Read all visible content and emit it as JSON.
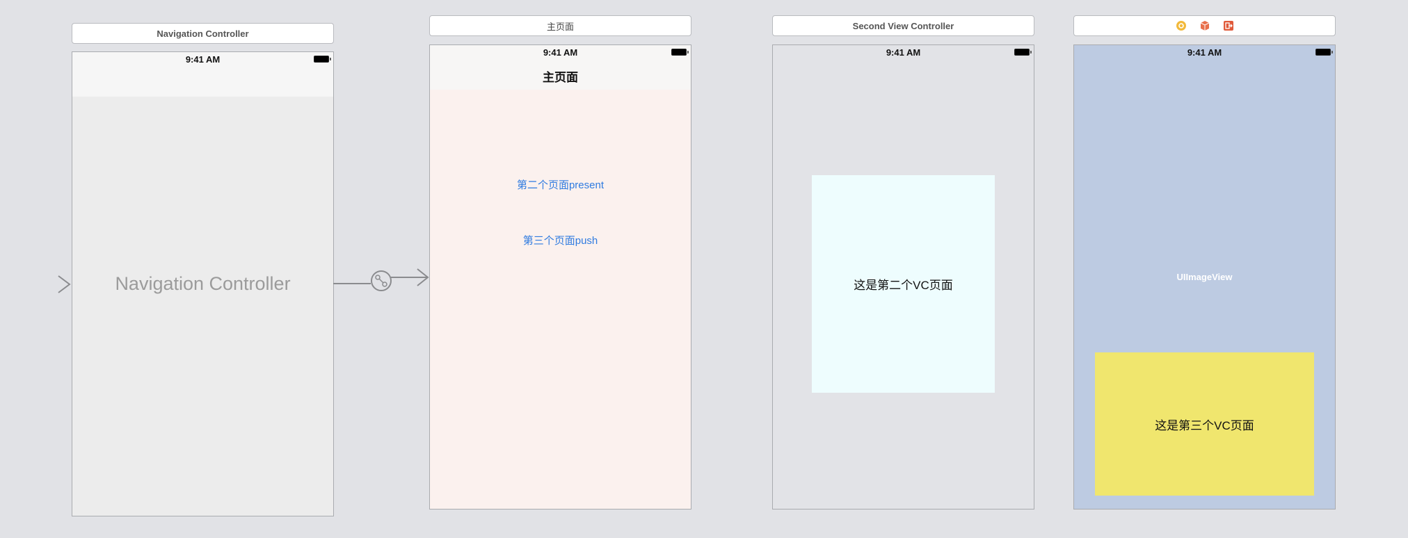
{
  "scenes": {
    "nav": {
      "title": "Navigation Controller",
      "time": "9:41 AM",
      "center_label": "Navigation Controller"
    },
    "main": {
      "title": "主页面",
      "time": "9:41 AM",
      "nav_title": "主页面",
      "buttons": {
        "present": "第二个页面present",
        "push": "第三个页面push"
      }
    },
    "second": {
      "title": "Second View Controller",
      "time": "9:41 AM",
      "panel_text": "这是第二个VC页面"
    },
    "third": {
      "title_icons": [
        "view-controller-icon",
        "first-responder-icon",
        "exit-icon"
      ],
      "time": "9:41 AM",
      "image_view_label": "UIImageView",
      "panel_text": "这是第三个VC页面"
    }
  },
  "colors": {
    "canvas": "#e1e2e6",
    "link": "#2f7be0",
    "main_bg": "#fbf1ee",
    "second_panel": "#eefdfe",
    "third_bg": "#bdcbe2",
    "third_panel": "#f0e66e"
  }
}
